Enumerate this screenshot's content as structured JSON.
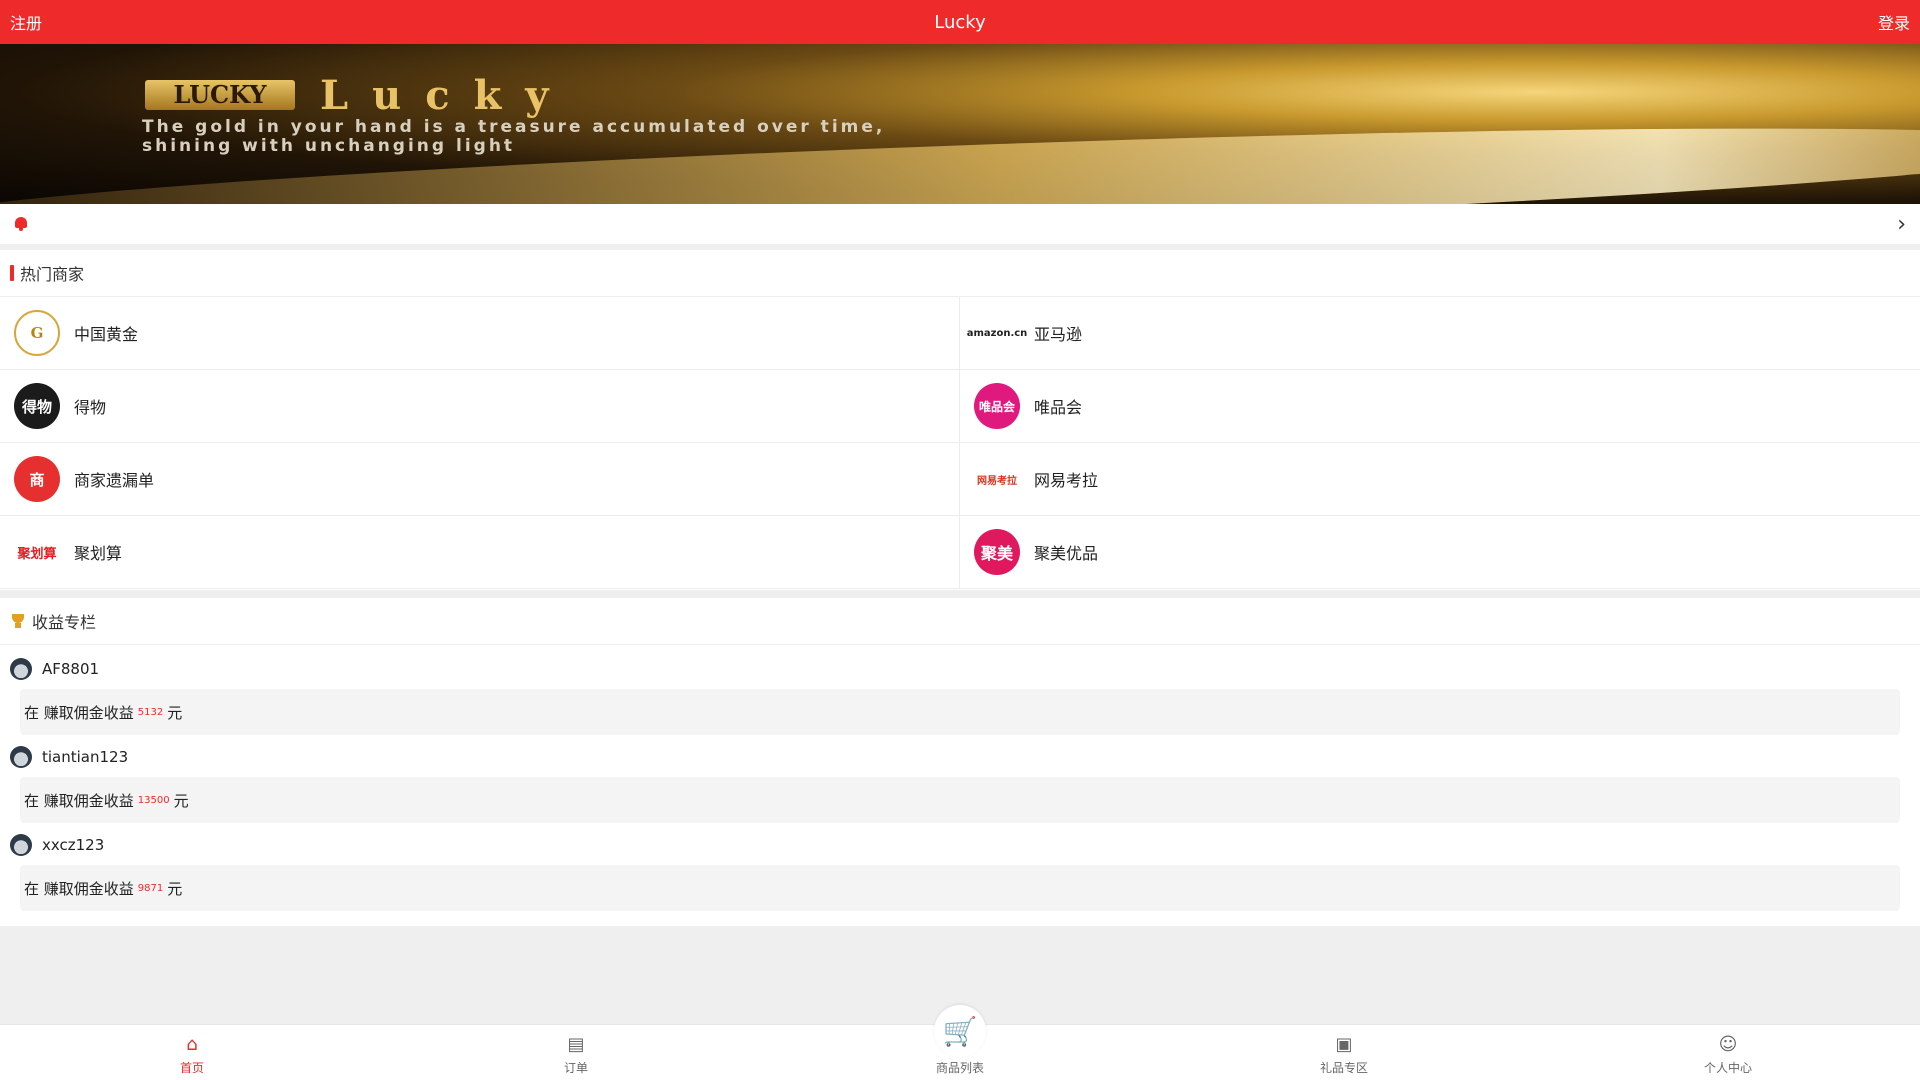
{
  "header": {
    "left": "注册",
    "title": "Lucky",
    "right": "登录"
  },
  "banner": {
    "logo_text": "LUCKY",
    "brand": "Lucky",
    "tagline": "The gold in your hand is a treasure accumulated over time, shining with unchanging light"
  },
  "hot": {
    "title": "热门商家",
    "merchants": [
      {
        "name": "中国黄金",
        "logo_text": "G",
        "logo_style": "gold"
      },
      {
        "name": "亚马逊",
        "logo_text": "amazon.cn",
        "logo_style": "amz"
      },
      {
        "name": "得物",
        "logo_text": "得物",
        "logo_style": "dark"
      },
      {
        "name": "唯品会",
        "logo_text": "唯品会",
        "logo_style": "pink"
      },
      {
        "name": "商家遗漏单",
        "logo_text": "商",
        "logo_style": "red"
      },
      {
        "name": "网易考拉",
        "logo_text": "网易考拉",
        "logo_style": "kaola"
      },
      {
        "name": "聚划算",
        "logo_text": "聚划算",
        "logo_style": "ju"
      },
      {
        "name": "聚美优品",
        "logo_text": "聚美",
        "logo_style": "jumei"
      }
    ]
  },
  "earnings": {
    "title": "收益专栏",
    "items": [
      {
        "user": "AF8801",
        "prefix": "在 赚取佣金收益",
        "amount": "5132",
        "unit": "元"
      },
      {
        "user": "tiantian123",
        "prefix": "在 赚取佣金收益",
        "amount": "13500",
        "unit": "元"
      },
      {
        "user": "xxcz123",
        "prefix": "在 赚取佣金收益",
        "amount": "9871",
        "unit": "元"
      }
    ]
  },
  "tabs": [
    {
      "label": "首页",
      "icon": "home-icon",
      "active": true
    },
    {
      "label": "订单",
      "icon": "order-icon",
      "active": false
    },
    {
      "label": "商品列表",
      "icon": "cart-icon",
      "active": false
    },
    {
      "label": "礼品专区",
      "icon": "gift-icon",
      "active": false
    },
    {
      "label": "个人中心",
      "icon": "user-icon",
      "active": false
    }
  ],
  "colors": {
    "accent": "#ee2a2b",
    "gold": "#e2a022"
  }
}
